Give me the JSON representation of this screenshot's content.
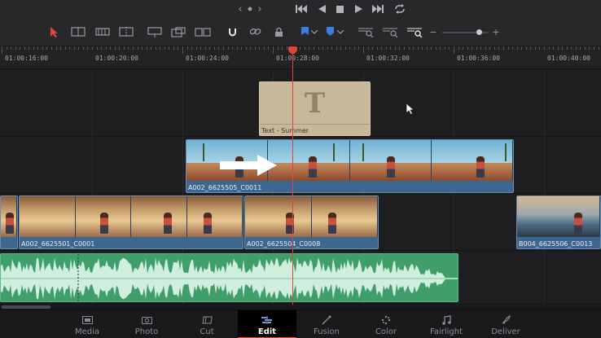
{
  "transport": {
    "nav_left": "‹",
    "nav_right": "›",
    "icons": [
      "jump-to-start-icon",
      "step-back-icon",
      "stop-icon",
      "play-icon",
      "jump-to-end-icon",
      "loop-icon"
    ]
  },
  "toolbar": {
    "zoom_minus": "−",
    "zoom_plus": "+",
    "zoom_level": 0.82
  },
  "ruler": {
    "labels": [
      "01:00:16:00",
      "01:00:20:00",
      "01:00:24:00",
      "01:00:28:00",
      "01:00:32:00",
      "01:00:36:00",
      "01:00:40:00"
    ]
  },
  "clips": {
    "title": {
      "glyph": "T",
      "label": "Text - Summer"
    },
    "video2": {
      "label": "A002_6625505_C0011"
    },
    "v1_a": {
      "label": ""
    },
    "v1_b": {
      "label": "A002_6625501_C0001"
    },
    "v1_c": {
      "label": "A002_6625504_C0008"
    },
    "v1_d": {
      "label": "B004_6625506_C0013"
    }
  },
  "pages": [
    {
      "label": "Media",
      "icon": "media-page-icon"
    },
    {
      "label": "Photo",
      "icon": "photo-page-icon"
    },
    {
      "label": "Cut",
      "icon": "cut-page-icon"
    },
    {
      "label": "Edit",
      "icon": "edit-page-icon",
      "active": true
    },
    {
      "label": "Fusion",
      "icon": "fusion-page-icon"
    },
    {
      "label": "Color",
      "icon": "color-page-icon"
    },
    {
      "label": "Fairlight",
      "icon": "fairlight-page-icon"
    },
    {
      "label": "Deliver",
      "icon": "deliver-page-icon"
    }
  ],
  "colors": {
    "playhead": "#e0453a",
    "video_clip": "#3d6790",
    "title_clip": "#c8b89a",
    "audio_clip": "#3f9e6a",
    "active_page_marker": "#e0453a"
  }
}
